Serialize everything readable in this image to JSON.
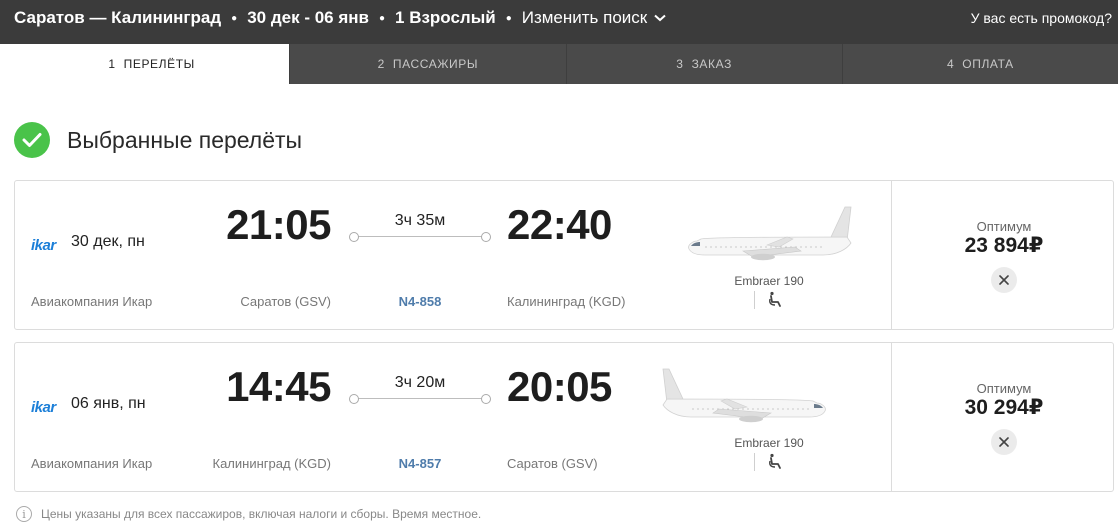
{
  "search": {
    "route": "Саратов — Калининград",
    "dates": "30 дек - 06 янв",
    "passengers": "1 Взрослый",
    "change_label": "Изменить поиск",
    "promo_label": "У вас есть промокод?"
  },
  "steps": [
    {
      "num": "1",
      "label": "Перелёты",
      "active": true
    },
    {
      "num": "2",
      "label": "Пассажиры",
      "active": false
    },
    {
      "num": "3",
      "label": "Заказ",
      "active": false
    },
    {
      "num": "4",
      "label": "Оплата",
      "active": false
    }
  ],
  "heading": "Выбранные перелёты",
  "flights": [
    {
      "logo": "ikar",
      "date": "30 дек, пн",
      "airline": "Авиакомпания Икар",
      "dep_time": "21:05",
      "arr_time": "22:40",
      "duration": "3ч 35м",
      "dep_airport": "Саратов (GSV)",
      "arr_airport": "Калининград (KGD)",
      "flight_no": "N4-858",
      "aircraft": "Embraer 190",
      "fare": "Оптимум",
      "price": "23 894₽"
    },
    {
      "logo": "ikar",
      "date": "06 янв, пн",
      "airline": "Авиакомпания Икар",
      "dep_time": "14:45",
      "arr_time": "20:05",
      "duration": "3ч 20м",
      "dep_airport": "Калининград (KGD)",
      "arr_airport": "Саратов (GSV)",
      "flight_no": "N4-857",
      "aircraft": "Embraer 190",
      "fare": "Оптимум",
      "price": "30 294₽"
    }
  ],
  "footnote": "Цены указаны для всех пассажиров, включая налоги и сборы. Время местное.",
  "colors": {
    "topbar": "#3b3b3b",
    "steps_bg": "#4a4a4a",
    "check_green": "#4ac34a",
    "logo_blue": "#1c7fd8",
    "flight_no_blue": "#4f7cab"
  },
  "icons": [
    "chevron-down-icon",
    "check-icon",
    "airplane-icon",
    "seat-icon",
    "close-icon",
    "info-icon"
  ]
}
